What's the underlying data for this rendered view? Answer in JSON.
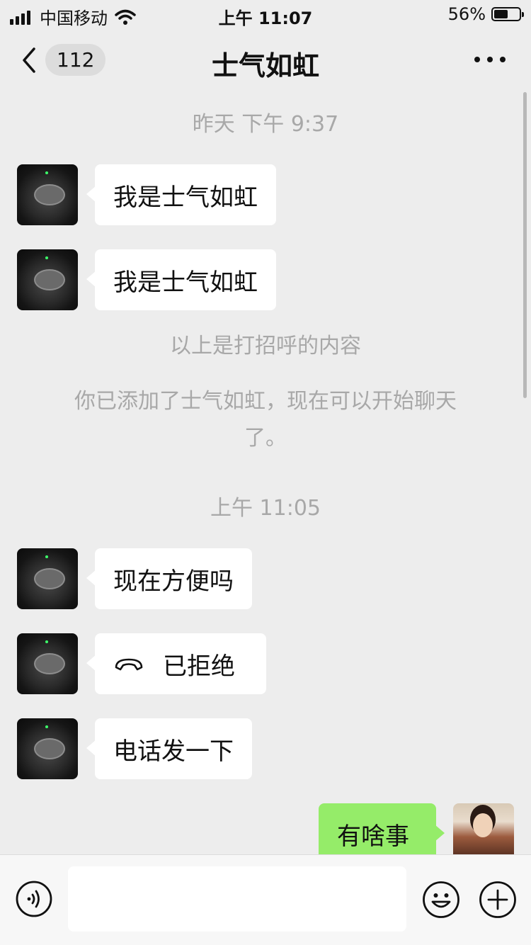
{
  "status_bar": {
    "carrier": "中国移动",
    "time": "上午 11:07",
    "battery_percent": "56%",
    "battery_level": 0.56,
    "icons": [
      "signal-icon",
      "wifi-icon",
      "battery-icon"
    ]
  },
  "nav": {
    "back_icon": "chevron-left-icon",
    "unread_count": "112",
    "title": "士气如虹",
    "more_icon": "more-dots-icon"
  },
  "messages": [
    {
      "type": "timestamp",
      "text": "昨天 下午 9:37"
    },
    {
      "type": "received",
      "text": "我是士气如虹",
      "avatar": "steering-wheel-avatar"
    },
    {
      "type": "received",
      "text": "我是士气如虹",
      "avatar": "steering-wheel-avatar"
    },
    {
      "type": "system",
      "text": "以上是打招呼的内容"
    },
    {
      "type": "system",
      "line1": "你已添加了士气如虹，现在可以开始聊天",
      "line2": "了。"
    },
    {
      "type": "timestamp",
      "text": "上午 11:05"
    },
    {
      "type": "received",
      "text": "现在方便吗",
      "avatar": "steering-wheel-avatar"
    },
    {
      "type": "received_call",
      "text": "已拒绝",
      "icon": "phone-hangup-icon",
      "avatar": "steering-wheel-avatar"
    },
    {
      "type": "received",
      "text": "电话发一下",
      "avatar": "steering-wheel-avatar"
    },
    {
      "type": "sent",
      "text": "有啥事",
      "avatar": "user-photo-avatar"
    }
  ],
  "input_bar": {
    "voice_icon": "voice-icon",
    "input_value": "",
    "emoji_icon": "emoji-icon",
    "plus_icon": "plus-icon"
  },
  "colors": {
    "background": "#ededed",
    "sent_bubble": "#95ec69",
    "received_bubble": "#ffffff",
    "system_text": "#a8a8a8"
  }
}
